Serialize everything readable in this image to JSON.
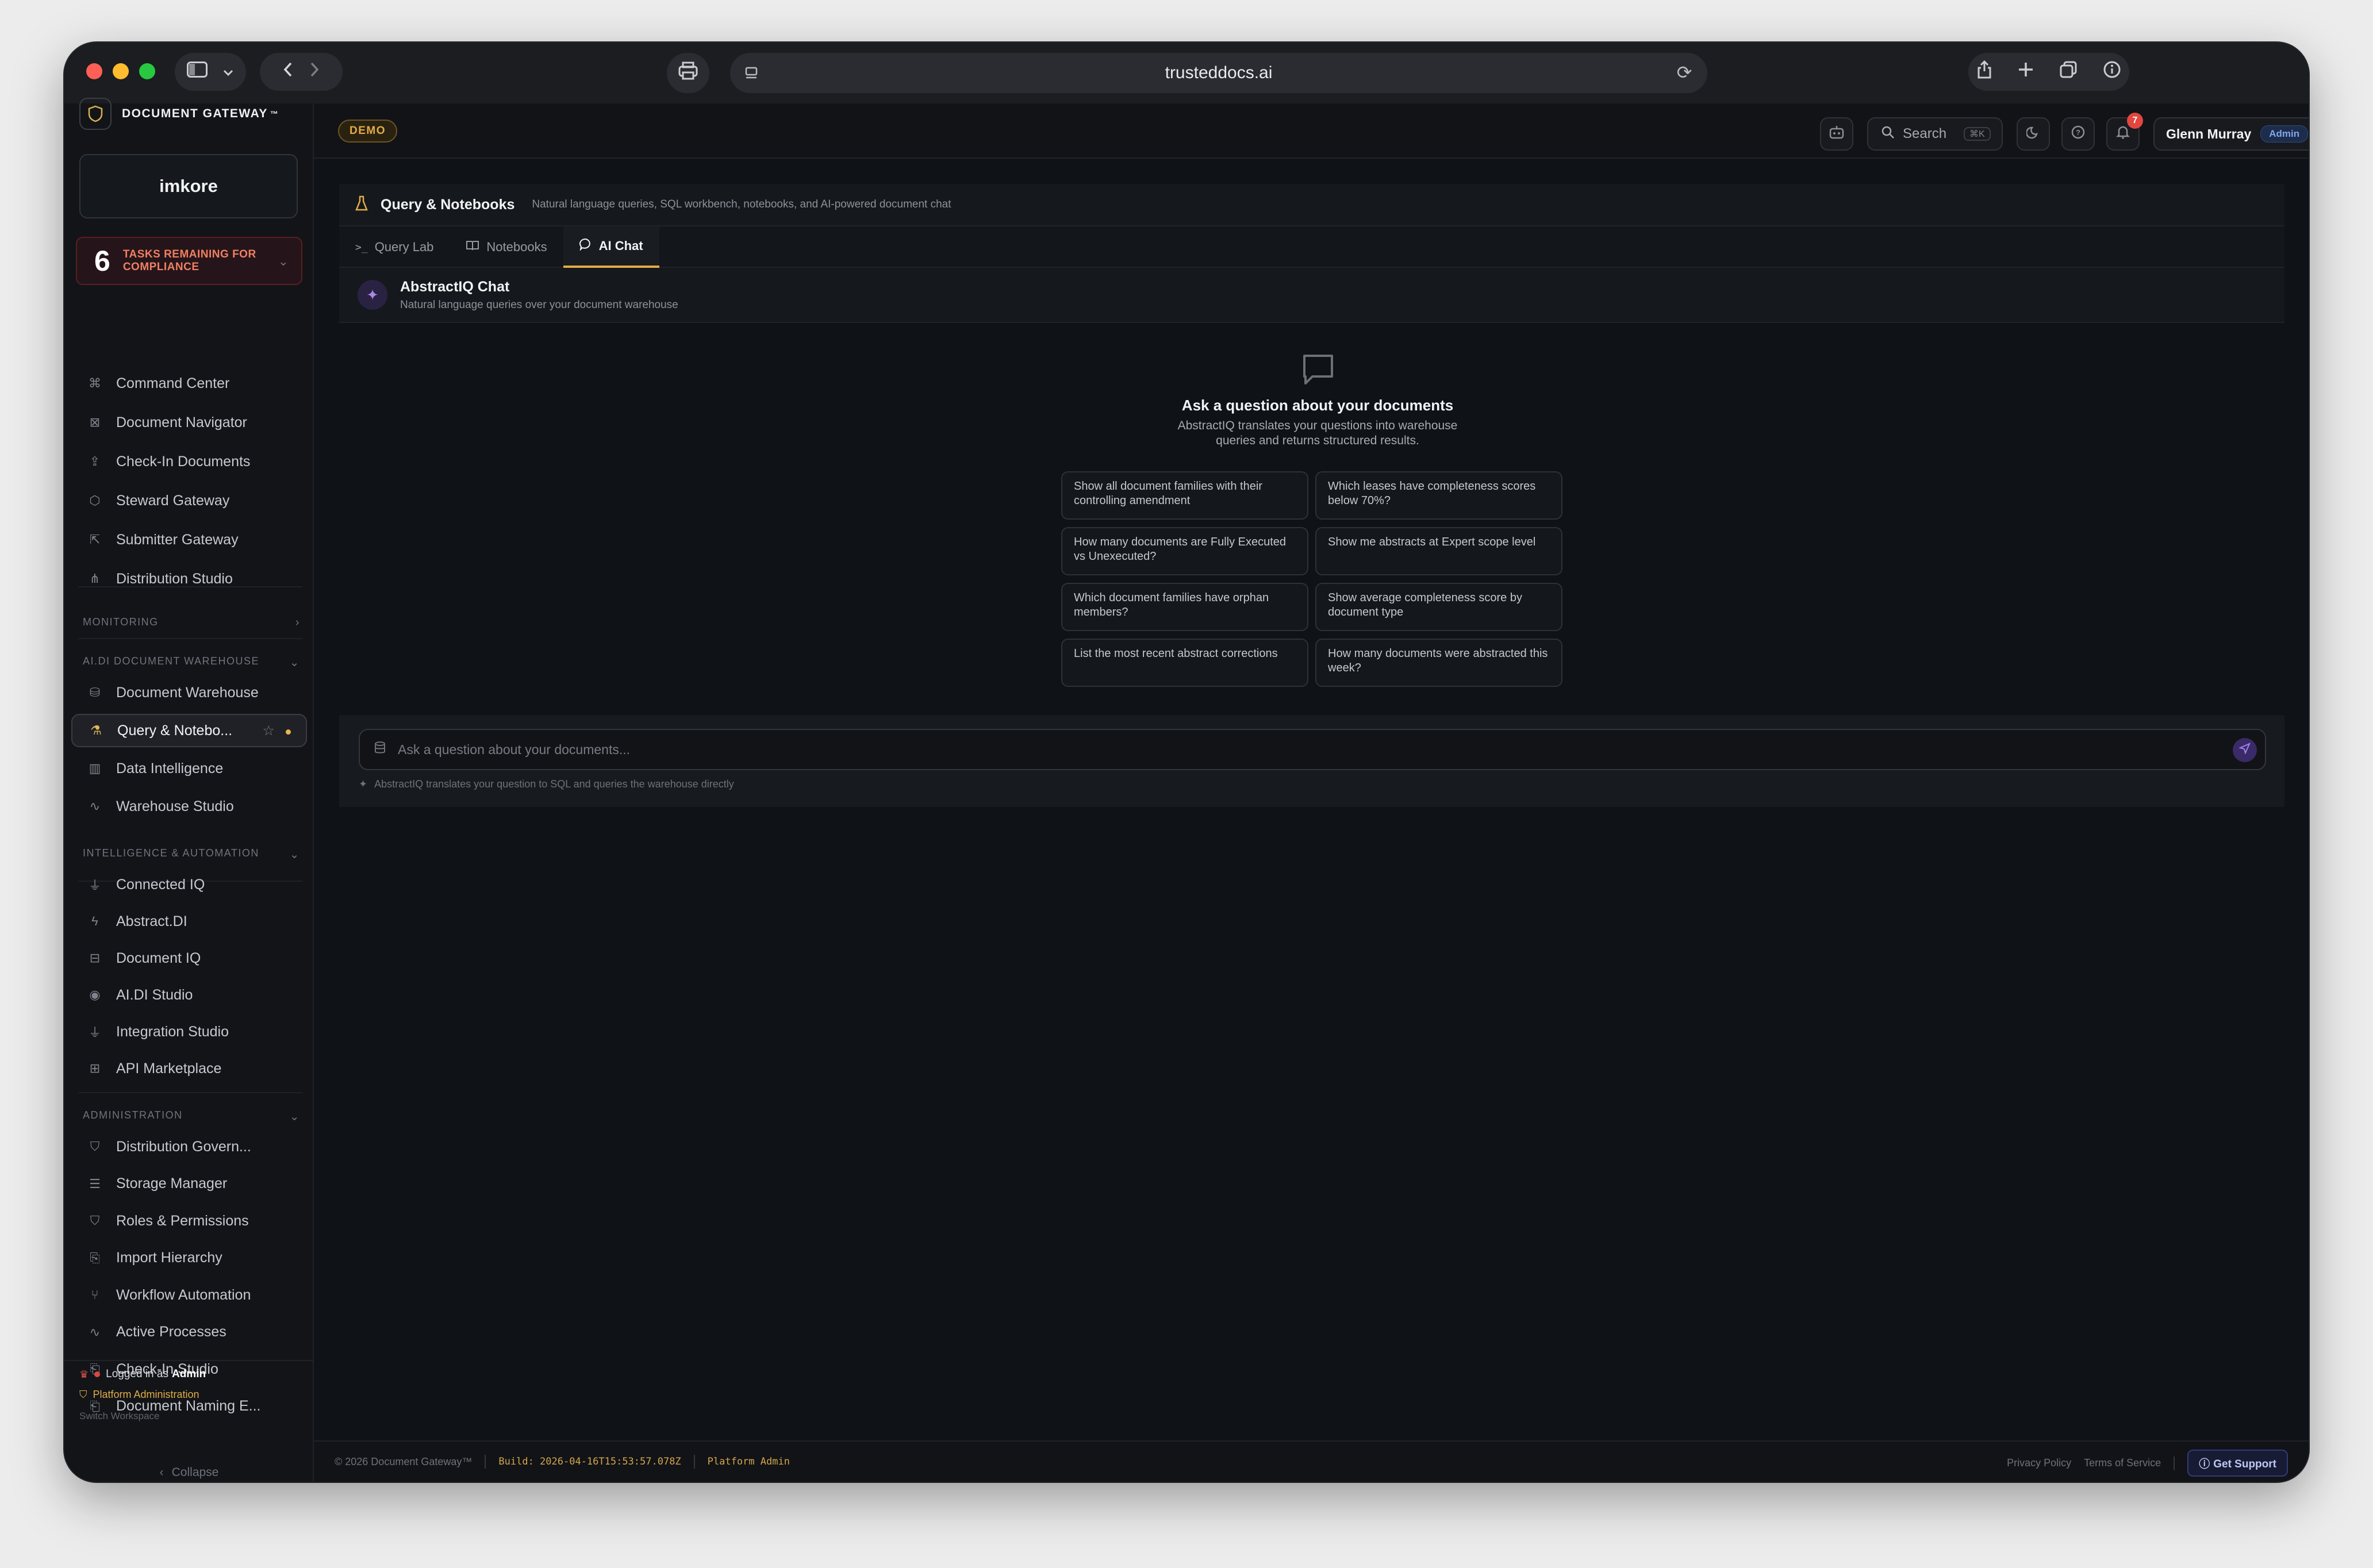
{
  "browser": {
    "url": "trusteddocs.ai"
  },
  "sidebar": {
    "brand": "DOCUMENT GATEWAY",
    "brand_mark": "™",
    "logo_text": "imkore",
    "tasks": {
      "count": "6",
      "label": "TASKS REMAINING FOR COMPLIANCE"
    },
    "main_items": [
      {
        "label": "Command Center",
        "icon": "command-icon"
      },
      {
        "label": "Document Navigator",
        "icon": "navigator-icon"
      },
      {
        "label": "Check-In Documents",
        "icon": "upload-icon"
      },
      {
        "label": "Steward Gateway",
        "icon": "cube-icon"
      },
      {
        "label": "Submitter Gateway",
        "icon": "external-icon"
      },
      {
        "label": "Distribution Studio",
        "icon": "share-icon"
      }
    ],
    "sections": {
      "monitoring": "MONITORING",
      "warehouse": "AI.DI DOCUMENT WAREHOUSE",
      "intelligence": "INTELLIGENCE & AUTOMATION",
      "administration": "ADMINISTRATION"
    },
    "warehouse_items": [
      {
        "label": "Document Warehouse"
      },
      {
        "label": "Query & Notebo..."
      },
      {
        "label": "Data Intelligence"
      },
      {
        "label": "Warehouse Studio"
      }
    ],
    "intelligence_items": [
      {
        "label": "Connected IQ"
      },
      {
        "label": "Abstract.DI"
      },
      {
        "label": "Document IQ"
      },
      {
        "label": "AI.DI Studio"
      },
      {
        "label": "Integration Studio"
      },
      {
        "label": "API Marketplace"
      }
    ],
    "admin_items": [
      {
        "label": "Distribution Govern..."
      },
      {
        "label": "Storage Manager"
      },
      {
        "label": "Roles & Permissions"
      },
      {
        "label": "Import Hierarchy"
      },
      {
        "label": "Workflow Automation"
      },
      {
        "label": "Active Processes"
      },
      {
        "label": "Check-In Studio"
      },
      {
        "label": "Document Naming E..."
      }
    ],
    "footer": {
      "logged_in_prefix": "Logged in as",
      "logged_in_role": "Admin",
      "platform_admin": "Platform Administration",
      "switch_workspace": "Switch Workspace",
      "collapse": "Collapse"
    }
  },
  "header": {
    "demo_badge": "DEMO",
    "search_label": "Search",
    "search_shortcut": "⌘K",
    "notification_count": "7",
    "user_name": "Glenn Murray",
    "user_role": "Admin"
  },
  "panel": {
    "title": "Query & Notebooks",
    "subtitle": "Natural language queries, SQL workbench, notebooks, and AI-powered document chat",
    "tabs": [
      {
        "label": "Query Lab"
      },
      {
        "label": "Notebooks"
      },
      {
        "label": "AI Chat"
      }
    ]
  },
  "chat": {
    "title": "AbstractIQ Chat",
    "subtitle": "Natural language queries over your document warehouse",
    "empty_title": "Ask a question about your documents",
    "empty_subtitle": "AbstractIQ translates your questions into warehouse queries and returns structured results.",
    "suggestions": [
      "Show all document families with their controlling amendment",
      "Which leases have completeness scores below 70%?",
      "How many documents are Fully Executed vs Unexecuted?",
      "Show me abstracts at Expert scope level",
      "Which document families have orphan members?",
      "Show average completeness score by document type",
      "List the most recent abstract corrections",
      "How many documents were abstracted this week?"
    ],
    "input_placeholder": "Ask a question about your documents...",
    "input_note": "AbstractIQ translates your question to SQL and queries the warehouse directly"
  },
  "footer": {
    "copyright": "© 2026 Document Gateway™",
    "build": "Build: 2026-04-16T15:53:57.078Z",
    "role": "Platform Admin",
    "privacy": "Privacy Policy",
    "terms": "Terms of Service",
    "support": "Get Support"
  },
  "colors": {
    "accent": "#e2ad45",
    "background": "#0f1216",
    "ai_purple": "#a78ae6",
    "danger": "#e2463f"
  }
}
